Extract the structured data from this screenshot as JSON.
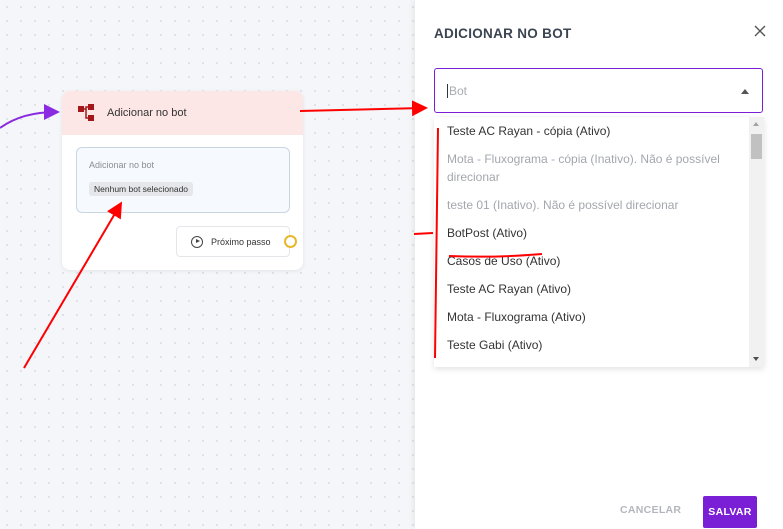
{
  "node": {
    "title": "Adicionar no bot",
    "field_label": "Adicionar no bot",
    "chip": "Nenhum bot selecionado",
    "next_step": "Próximo passo"
  },
  "panel": {
    "title": "ADICIONAR NO BOT",
    "select_placeholder": "Bot",
    "options": [
      {
        "label": "Teste AC Rayan - cópia (Ativo)",
        "disabled": false
      },
      {
        "label": "Mota - Fluxograma - cópia (Inativo). Não é possível direcionar",
        "disabled": true
      },
      {
        "label": "teste 01 (Inativo). Não é possível direcionar",
        "disabled": true
      },
      {
        "label": "BotPost (Ativo)",
        "disabled": false
      },
      {
        "label": "Casos de Uso (Ativo)",
        "disabled": false
      },
      {
        "label": "Teste AC Rayan (Ativo)",
        "disabled": false
      },
      {
        "label": "Mota - Fluxograma (Ativo)",
        "disabled": false
      },
      {
        "label": "Teste Gabi (Ativo)",
        "disabled": false
      }
    ],
    "cancel_label": "CANCELAR",
    "save_label": "SALVAR"
  },
  "colors": {
    "accent": "#7a1fd6",
    "node_header": "#fde6e6",
    "annotation": "#ff0000",
    "port": "#e9b82a"
  }
}
